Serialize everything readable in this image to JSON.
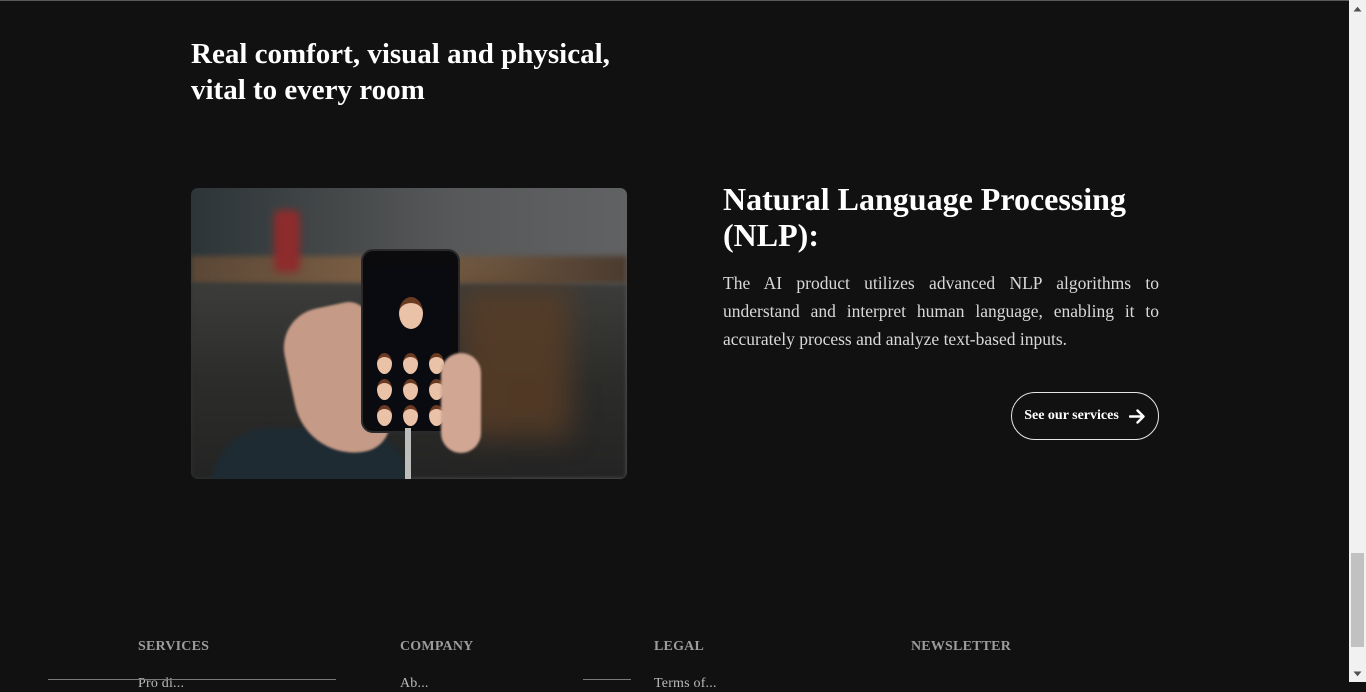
{
  "hero": {
    "heading_line1": "Real comfort, visual and physical,",
    "heading_line2": "vital to every room"
  },
  "feature": {
    "title_line1": "Natural Language Processing",
    "title_line2": "(NLP):",
    "description": "The AI product utilizes advanced NLP algorithms to understand and interpret human language, enabling it to accurately process and analyze text-based inputs.",
    "button_label": "See our services",
    "image_alt": "hand holding phone showing memoji avatars"
  },
  "footer": {
    "columns": [
      {
        "title": "SERVICES",
        "first_item": "Pro di..."
      },
      {
        "title": "COMPANY",
        "first_item": "Ab..."
      },
      {
        "title": "LEGAL",
        "first_item": "Terms of..."
      },
      {
        "title": "NEWSLETTER",
        "first_item": ""
      }
    ]
  },
  "colors": {
    "background": "#121112",
    "text": "#ffffff",
    "muted": "#9c9c9c"
  },
  "icons": {
    "button_icon": "arrow-right-icon",
    "scroll_up": "scroll-up-arrow-icon",
    "scroll_down": "scroll-down-arrow-icon"
  }
}
